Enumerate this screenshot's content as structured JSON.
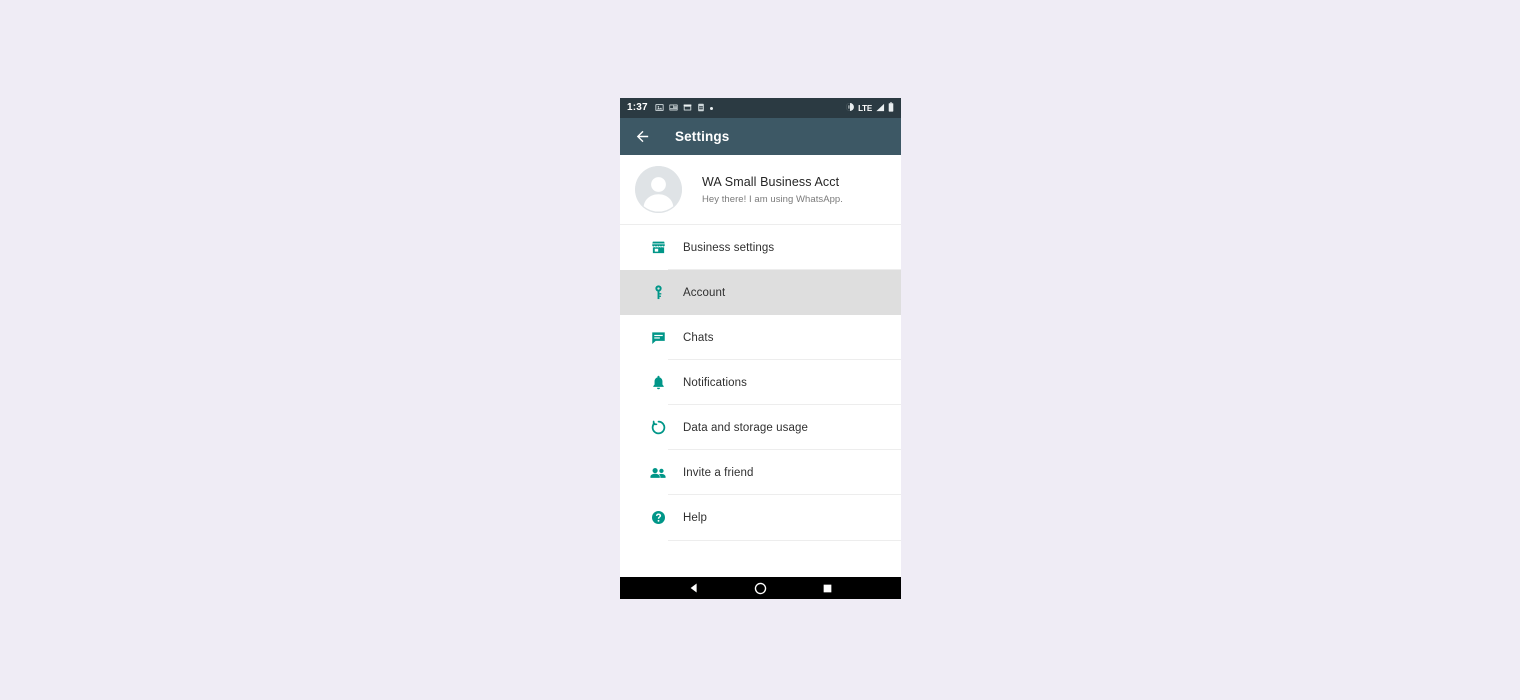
{
  "status_bar": {
    "clock": "1:37",
    "network_label": "LTE",
    "left_icons": [
      "photo-icon",
      "news-icon",
      "calendar-icon",
      "sim-card-icon",
      "dot-icon"
    ],
    "right_icons": [
      "volume-icon",
      "signal-icon",
      "battery-icon"
    ],
    "background": "#2b3a42"
  },
  "app_bar": {
    "title": "Settings",
    "back_icon": "back-arrow-icon",
    "background": "#3d5865"
  },
  "profile": {
    "name": "WA Small Business Acct",
    "status": "Hey there! I am using WhatsApp.",
    "avatar_icon": "default-avatar-icon"
  },
  "theme": {
    "accent": "#009688",
    "page_background": "#efecf5",
    "selected_row": "#dedede",
    "divider": "#ededed"
  },
  "menu": {
    "items": [
      {
        "label": "Business settings",
        "icon": "storefront-icon",
        "selected": false
      },
      {
        "label": "Account",
        "icon": "key-icon",
        "selected": true
      },
      {
        "label": "Chats",
        "icon": "chat-icon",
        "selected": false
      },
      {
        "label": "Notifications",
        "icon": "bell-icon",
        "selected": false
      },
      {
        "label": "Data and storage usage",
        "icon": "sync-circle-icon",
        "selected": false
      },
      {
        "label": "Invite a friend",
        "icon": "people-icon",
        "selected": false
      },
      {
        "label": "Help",
        "icon": "help-circle-icon",
        "selected": false
      }
    ]
  },
  "nav_bar": {
    "back_label": "back-triangle-icon",
    "home_label": "home-circle-icon",
    "recents_label": "recents-square-icon"
  }
}
